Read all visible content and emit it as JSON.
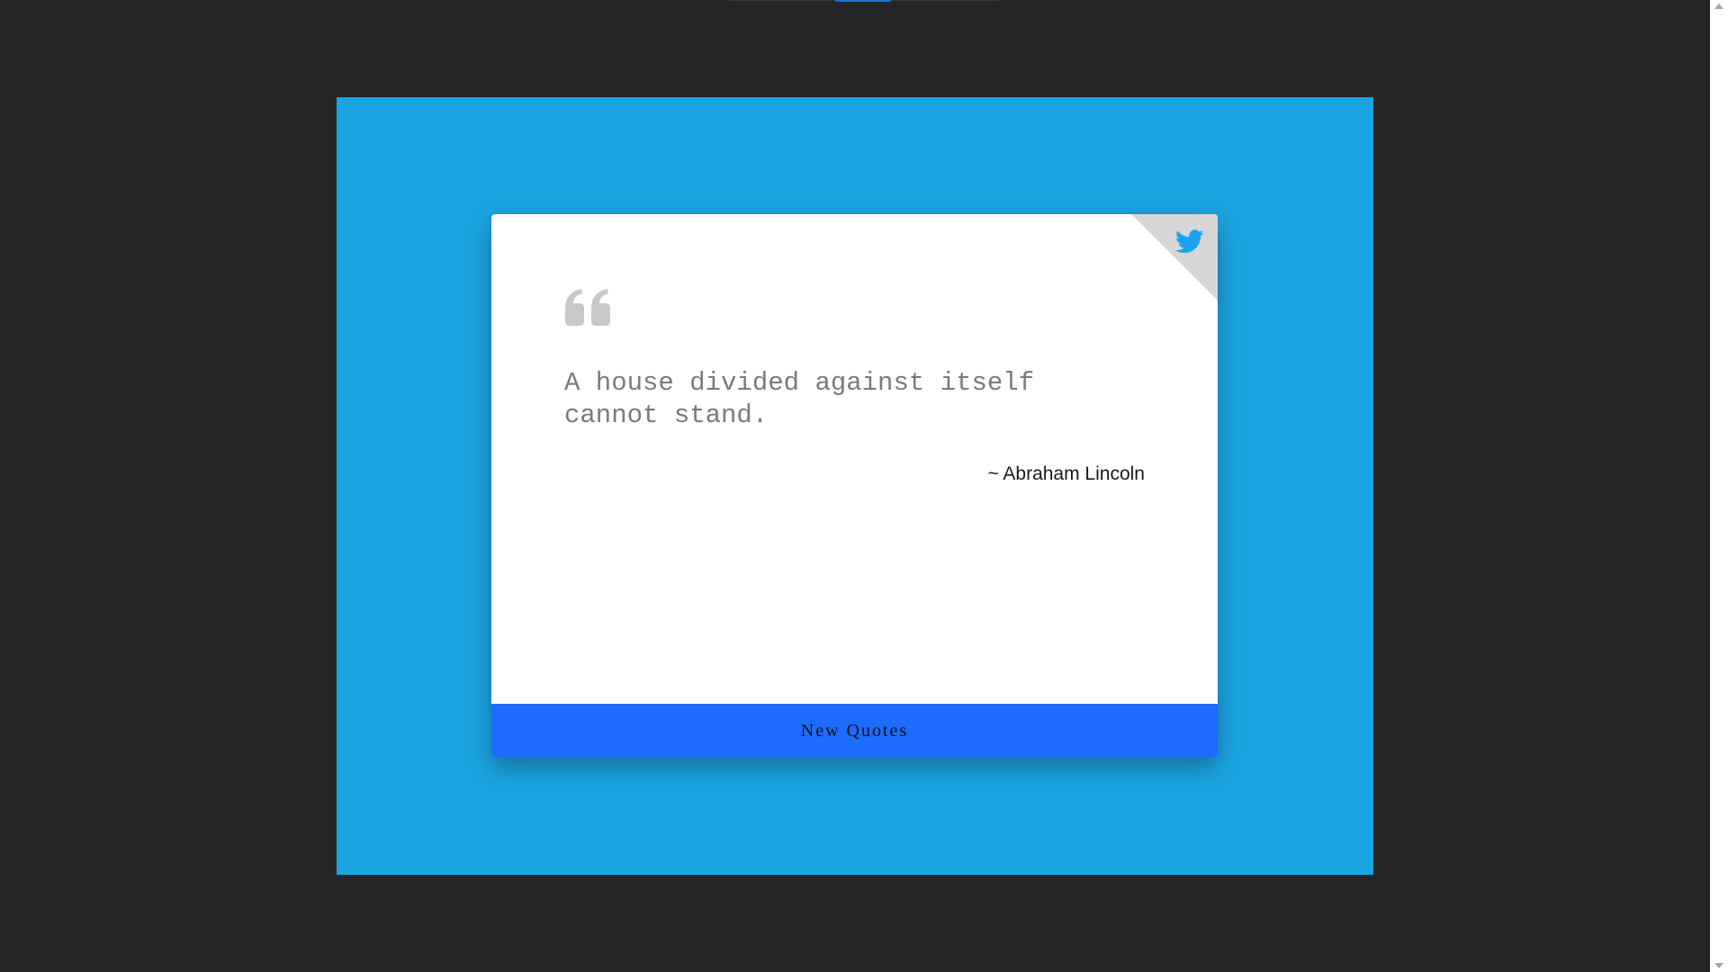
{
  "colors": {
    "page_background": "#252525",
    "stage_background": "#1ba4e2",
    "card_background": "#ffffff",
    "button_background": "#1e6bff",
    "twitter_blue": "#1da1f2",
    "quote_text": "#7a7a7a",
    "quote_mark": "#c8c8c8"
  },
  "card": {
    "quote_icon": "quote-left-icon",
    "quote_text": "A house divided against itself cannot stand.",
    "author": "~ Abraham Lincoln",
    "share_icon": "twitter-icon"
  },
  "actions": {
    "new_quote_label": "New Quotes"
  }
}
